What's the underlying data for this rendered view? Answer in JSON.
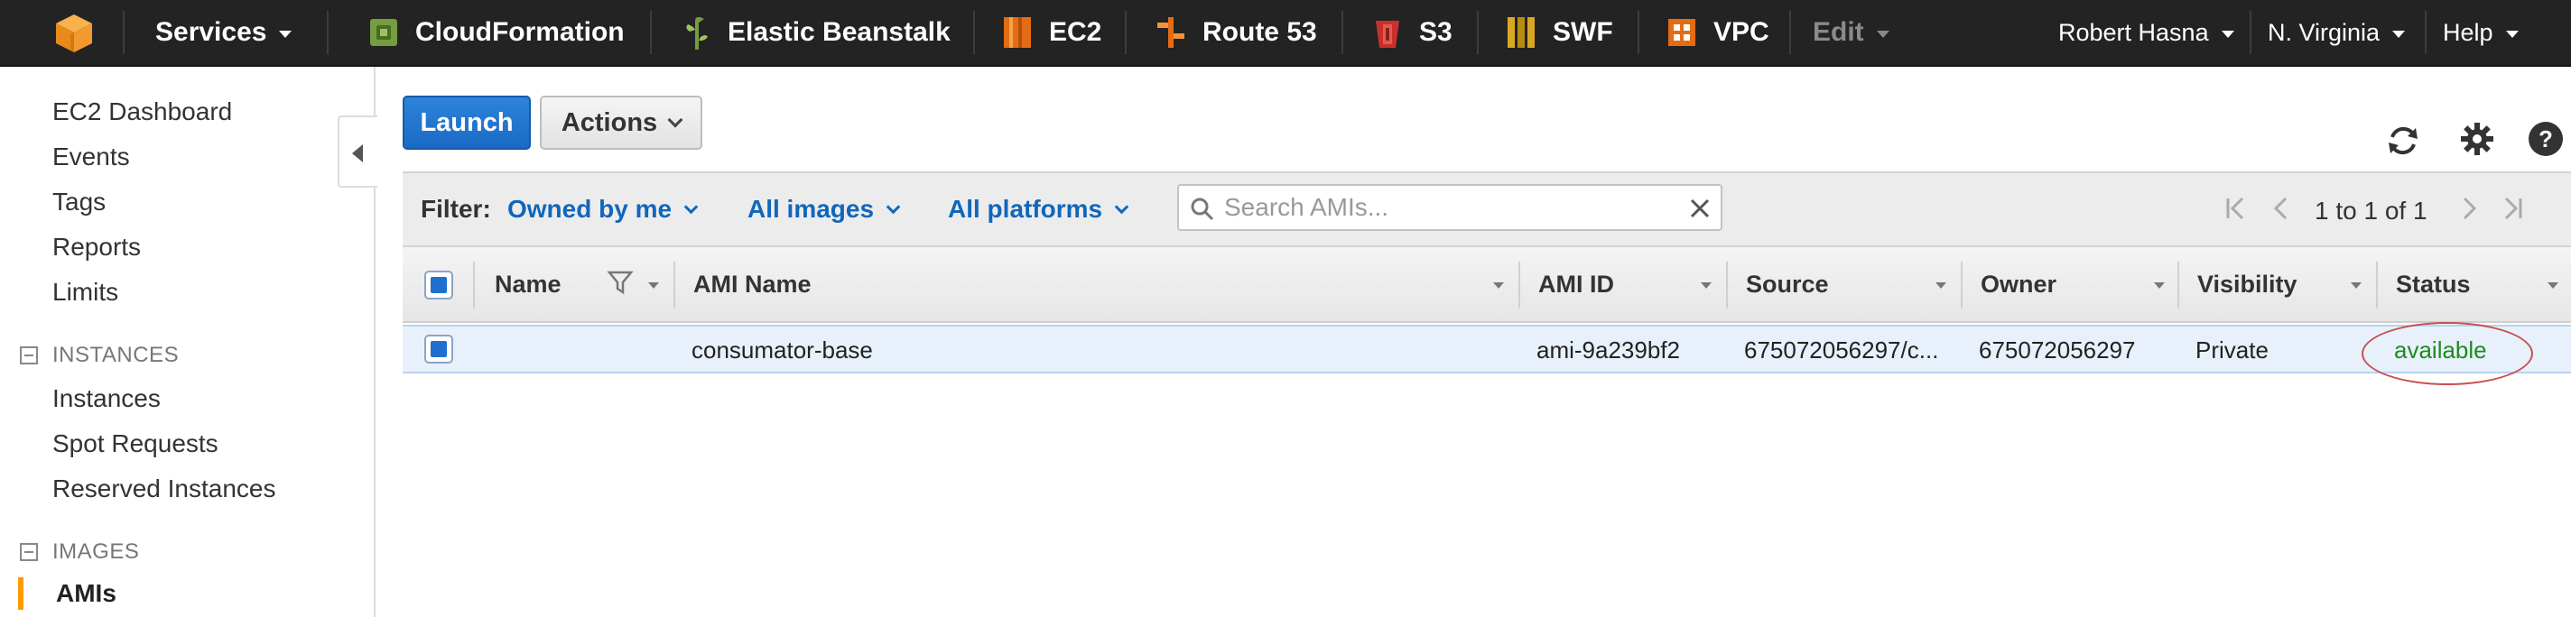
{
  "topnav": {
    "services_label": "Services",
    "items": [
      {
        "label": "CloudFormation",
        "icon": "cloudformation-icon"
      },
      {
        "label": "Elastic Beanstalk",
        "icon": "elastic-beanstalk-icon"
      },
      {
        "label": "EC2",
        "icon": "ec2-icon"
      },
      {
        "label": "Route 53",
        "icon": "route53-icon"
      },
      {
        "label": "S3",
        "icon": "s3-icon"
      },
      {
        "label": "SWF",
        "icon": "swf-icon"
      },
      {
        "label": "VPC",
        "icon": "vpc-icon"
      }
    ],
    "edit_label": "Edit",
    "user_label": "Robert Hasna",
    "region_label": "N. Virginia",
    "help_label": "Help",
    "colors": {
      "bar": "#232323",
      "aws_orange": "#f90"
    }
  },
  "sidebar": {
    "links": [
      "EC2 Dashboard",
      "Events",
      "Tags",
      "Reports",
      "Limits"
    ],
    "instances_header": "INSTANCES",
    "instances_links": [
      "Instances",
      "Spot Requests",
      "Reserved Instances"
    ],
    "images_header": "IMAGES",
    "images_links": [
      "AMIs"
    ],
    "active": "AMIs"
  },
  "toolbar": {
    "launch_label": "Launch",
    "actions_label": "Actions"
  },
  "filter": {
    "label": "Filter:",
    "owned": "Owned by me",
    "images": "All images",
    "platforms": "All platforms",
    "search_placeholder": "Search AMIs..."
  },
  "pager": {
    "text": "1 to 1 of 1"
  },
  "table": {
    "headers": [
      "Name",
      "AMI Name",
      "AMI ID",
      "Source",
      "Owner",
      "Visibility",
      "Status"
    ],
    "rows": [
      {
        "name": "",
        "ami_name": "consumator-base",
        "ami_id": "ami-9a239bf2",
        "source": "675072056297/c...",
        "owner": "675072056297",
        "visibility": "Private",
        "status": "available",
        "selected": true
      }
    ]
  },
  "colors": {
    "primary_blue": "#1a6ac4",
    "link_blue": "#1166bb",
    "status_green": "#1e8a1e",
    "selected_row": "#e8f1fb"
  }
}
